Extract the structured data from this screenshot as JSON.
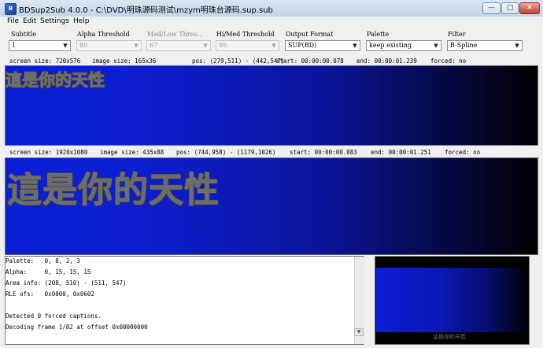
{
  "window": {
    "title": "BDSup2Sub 4.0.0 - C:\\DVD\\明珠源码测试\\mzym明珠台源码.sup.sub",
    "app_icon_text": "B",
    "minimize_glyph": "—",
    "maximize_glyph": "□",
    "close_glyph": "✕"
  },
  "menu": [
    "File",
    "Edit",
    "Settings",
    "Help"
  ],
  "controls": {
    "subtitle": {
      "label": "Subtitle",
      "value": "1"
    },
    "alpha_threshold": {
      "label": "Alpha Threshold",
      "value": "80"
    },
    "med_low_threshold": {
      "label": "Med/Low Thres...",
      "value": "67"
    },
    "hi_med_threshold": {
      "label": "Hi/Med Threshold",
      "value": "95"
    },
    "output_format": {
      "label": "Output Format",
      "value": "SUP(BD)"
    },
    "palette": {
      "label": "Palette",
      "value": "keep existing"
    },
    "filter": {
      "label": "Filter",
      "value": "B-Spline"
    },
    "dropdown_arrow": "▼"
  },
  "source_info": {
    "screen_size": "screen size:  720x576",
    "image_size": "image size:  165x36",
    "pos": "pos:  (279,511)  -  (442,547)",
    "start": "start:  00:00:00.078",
    "end": "end:  00:00:01.239",
    "forced": "forced:  no"
  },
  "source_subtitle_text": "這是你的天性",
  "target_info": {
    "screen_size": "screen size:  1920x1080",
    "image_size": "image size:  435x88",
    "pos": "pos:  (744,958)  -  (1179,1026)",
    "start": "start:  00:00:00.083",
    "end": "end:  00:00:01.251",
    "forced": "forced:  no"
  },
  "target_subtitle_text": "這是你的天性",
  "log": [
    "Palette:   0, 8, 2, 3",
    "Alpha:     0, 15, 15, 15",
    "Area info: (208, 510) - (511, 547)",
    "RLE ofs:   0x0000, 0x0602",
    "",
    "Detected 0 forced captions.",
    "Decoding frame 1/82 at offset 0x00000000"
  ],
  "scroll_down_glyph": "▼",
  "thumbnail_subtitle_text": "這是你的天性",
  "colors": {
    "preview_left": "#0a1ed6",
    "preview_right": "#000000",
    "subtitle_gray": "#6c6c6c"
  }
}
